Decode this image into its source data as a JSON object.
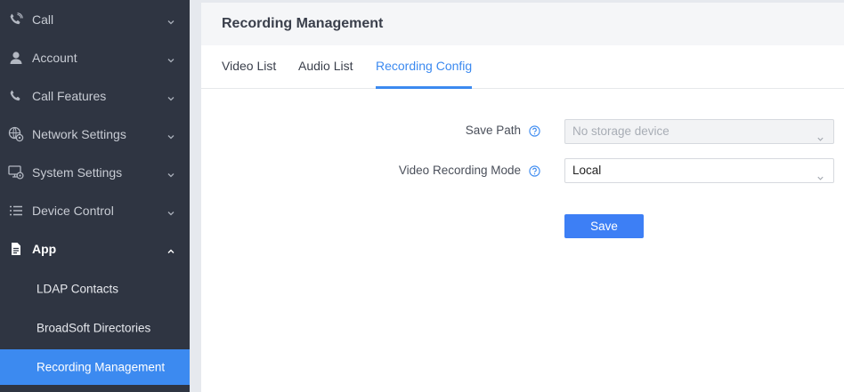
{
  "sidebar": {
    "items": [
      {
        "label": "Call",
        "icon": "phone-icon"
      },
      {
        "label": "Account",
        "icon": "user-icon"
      },
      {
        "label": "Call Features",
        "icon": "phone-icon"
      },
      {
        "label": "Network Settings",
        "icon": "globe-gear-icon"
      },
      {
        "label": "System Settings",
        "icon": "monitor-gear-icon"
      },
      {
        "label": "Device Control",
        "icon": "list-icon"
      },
      {
        "label": "App",
        "icon": "document-icon",
        "expanded": true
      }
    ],
    "app_children": [
      {
        "label": "LDAP Contacts"
      },
      {
        "label": "BroadSoft Directories"
      },
      {
        "label": "Recording Management",
        "active": true
      }
    ]
  },
  "header": {
    "title": "Recording Management"
  },
  "tabs": [
    {
      "label": "Video List"
    },
    {
      "label": "Audio List"
    },
    {
      "label": "Recording Config",
      "active": true
    }
  ],
  "form": {
    "save_path": {
      "label": "Save Path",
      "value": "No storage device",
      "disabled": true
    },
    "video_recording_mode": {
      "label": "Video Recording Mode",
      "value": "Local"
    },
    "save_button": "Save"
  },
  "colors": {
    "sidebar_bg": "#2f3542",
    "accent": "#3c8af0",
    "button": "#3d7ff5"
  }
}
